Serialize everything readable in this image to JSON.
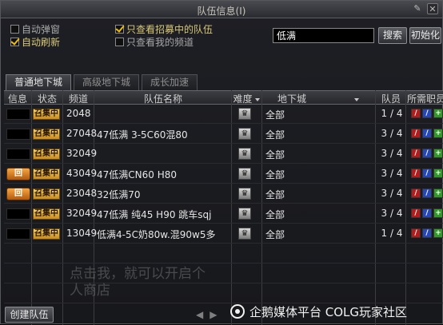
{
  "window": {
    "title": "队伍信息(I)",
    "pin_icon": "pin-icon",
    "close_icon": "close-icon"
  },
  "options": {
    "auto_bullet": {
      "label": "自动弹窗",
      "checked": false
    },
    "auto_refresh": {
      "label": "自动刷新",
      "checked": true
    },
    "only_recruiting": {
      "label": "只查看招募中的队伍",
      "checked": true
    },
    "only_my_channel": {
      "label": "只查看我的频道",
      "checked": false
    }
  },
  "search": {
    "value": "低满",
    "button": "搜索",
    "reset_button": "初始化"
  },
  "tabs": [
    {
      "label": "普通地下城",
      "active": true
    },
    {
      "label": "高级地下城",
      "active": false
    },
    {
      "label": "成长加速",
      "active": false
    }
  ],
  "table": {
    "headers": {
      "info": "信息",
      "status": "状态",
      "channel": "频道",
      "team_name": "队伍名称",
      "difficulty": "难度",
      "dungeon": "地下城",
      "members": "队员",
      "classes": "所需职员"
    },
    "rows": [
      {
        "badge": "",
        "status": "召集中",
        "channel": "2048",
        "name": "",
        "dungeon": "全部",
        "members": "1 / 4"
      },
      {
        "badge": "",
        "status": "召集中",
        "channel": "27048",
        "name": "47低满  3-5C60混80",
        "dungeon": "全部",
        "members": "3 / 4"
      },
      {
        "badge": "",
        "status": "召集中",
        "channel": "32049",
        "name": "",
        "dungeon": "全部",
        "members": "3 / 4"
      },
      {
        "badge": "回",
        "status": "召集中",
        "channel": "43049",
        "name": "47低满CN60   H80",
        "dungeon": "全部",
        "members": "3 / 4"
      },
      {
        "badge": "回",
        "status": "召集中",
        "channel": "23048",
        "name": "32低满70",
        "dungeon": "全部",
        "members": "3 / 4"
      },
      {
        "badge": "",
        "status": "召集中",
        "channel": "32049",
        "name": "47低满  纯45 H90 跳车sqj",
        "dungeon": "全部",
        "members": "3 / 4"
      },
      {
        "badge": "",
        "status": "召集中",
        "channel": "13049",
        "name": "低满4-5C奶80w.混90w5多",
        "dungeon": "全部",
        "members": "1 / 4"
      }
    ]
  },
  "footer": {
    "create_button": "创建队伍",
    "prev": "◀",
    "next": "▶"
  },
  "overlay": {
    "line1": "点击我，就可以开启个",
    "line2": "人商店"
  },
  "watermark": {
    "text": "企鹅媒体平台 COLG玩家社区"
  },
  "colors": {
    "accent_gold": "#f0c000",
    "status_fill": "#f5d36a"
  }
}
